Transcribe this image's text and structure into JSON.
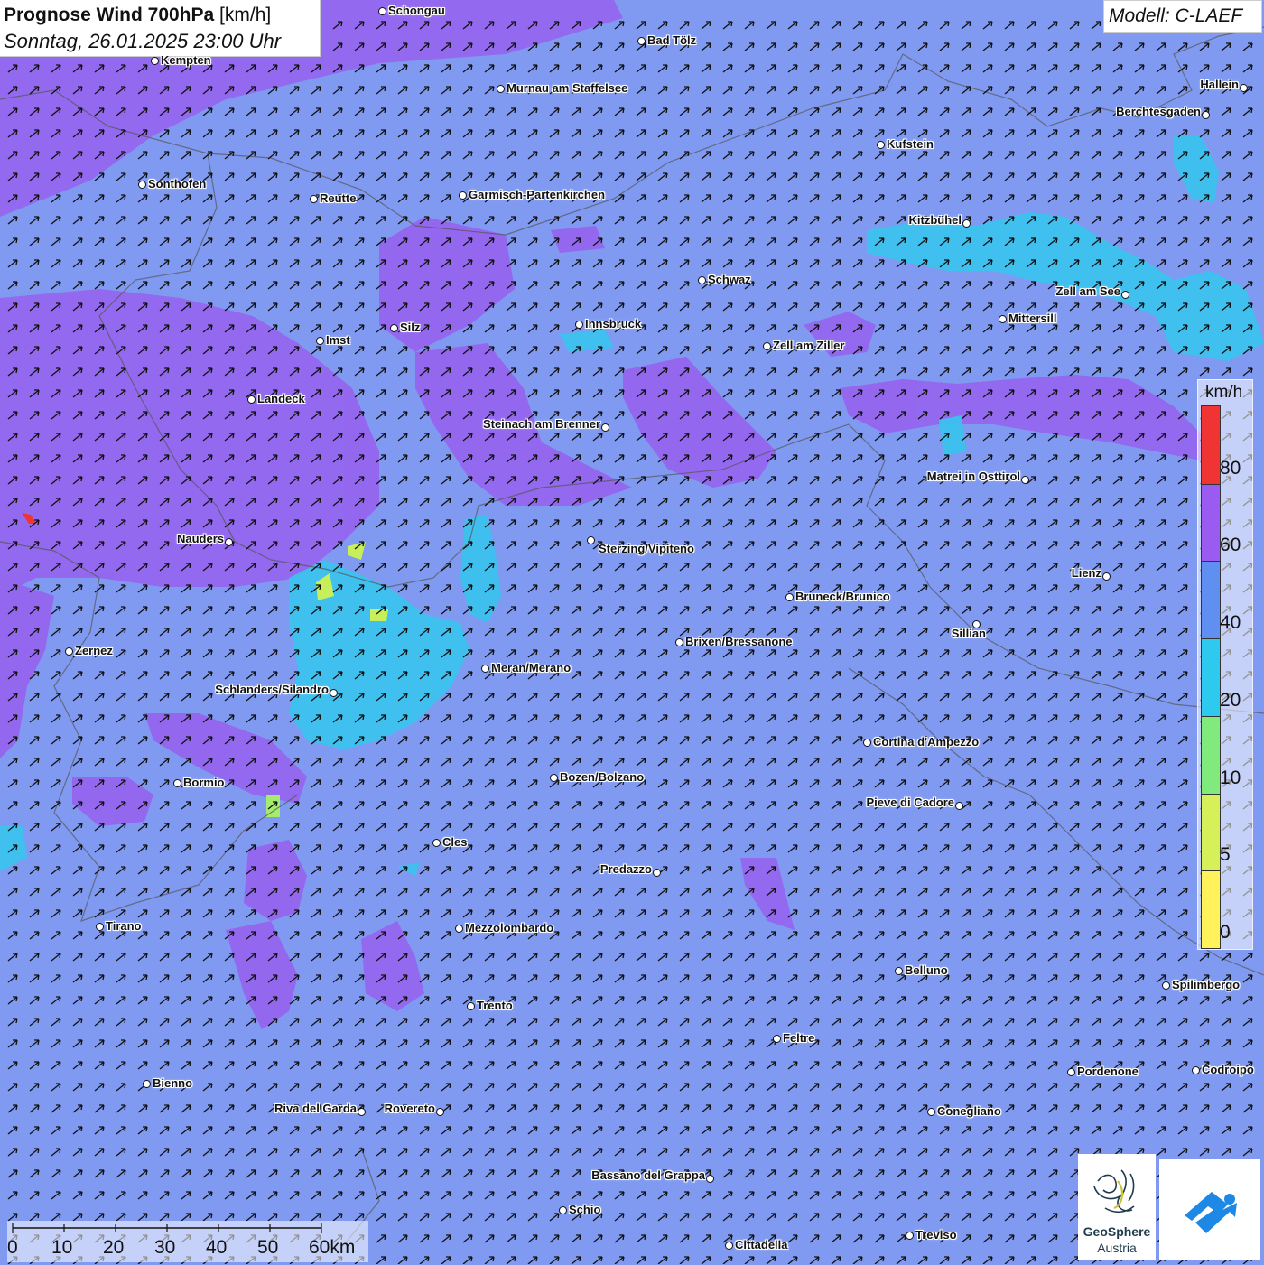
{
  "header": {
    "title_bold": "Prognose Wind 700hPa",
    "title_unit": "[km/h]",
    "datetime": "Sonntag, 26.01.2025 23:00 Uhr",
    "model": "Modell: C-LAEF"
  },
  "legend": {
    "unit": "km/h",
    "classes": [
      {
        "label": "0",
        "color": "#fff25a"
      },
      {
        "label": "5",
        "color": "#d6f05a"
      },
      {
        "label": "10",
        "color": "#80ea7c"
      },
      {
        "label": "20",
        "color": "#2ec9ee"
      },
      {
        "label": "40",
        "color": "#5f8ff0"
      },
      {
        "label": "60",
        "color": "#9a5cf0"
      },
      {
        "label": "80",
        "color": "#f03434"
      }
    ]
  },
  "scale": {
    "labels": [
      "0",
      "10",
      "20",
      "30",
      "40",
      "50",
      "60km"
    ]
  },
  "logo": {
    "name_bold": "GeoSphere",
    "name_light": "Austria"
  },
  "wind": {
    "direction": "southwest-to-northeast",
    "arrow_color": "#111111",
    "background_color": "#7f9af0"
  },
  "cities": [
    {
      "name": "Schongau"
    },
    {
      "name": "Bad Tölz"
    },
    {
      "name": "Kempten"
    },
    {
      "name": "Murnau am Staffelsee"
    },
    {
      "name": "Hallein"
    },
    {
      "name": "Berchtesgaden"
    },
    {
      "name": "Kufstein"
    },
    {
      "name": "Sonthofen"
    },
    {
      "name": "Reutte"
    },
    {
      "name": "Garmisch-Partenkirchen"
    },
    {
      "name": "Kitzbühel"
    },
    {
      "name": "Schwaz"
    },
    {
      "name": "Zell am See"
    },
    {
      "name": "Mittersill"
    },
    {
      "name": "Innsbruck"
    },
    {
      "name": "Imst"
    },
    {
      "name": "Silz"
    },
    {
      "name": "Zell am Ziller"
    },
    {
      "name": "Landeck"
    },
    {
      "name": "Steinach am Brenner"
    },
    {
      "name": "Matrei in Osttirol"
    },
    {
      "name": "Nauders"
    },
    {
      "name": "Sterzing/Vipiteno"
    },
    {
      "name": "Lienz"
    },
    {
      "name": "Bruneck/Brunico"
    },
    {
      "name": "Sillian"
    },
    {
      "name": "Zernez"
    },
    {
      "name": "Brixen/Bressanone"
    },
    {
      "name": "Meran/Merano"
    },
    {
      "name": "Schlanders/Silandro"
    },
    {
      "name": "Cortina d'Ampezzo"
    },
    {
      "name": "Bozen/Bolzano"
    },
    {
      "name": "Bormio"
    },
    {
      "name": "Pieve di Cadore"
    },
    {
      "name": "Cles"
    },
    {
      "name": "Predazzo"
    },
    {
      "name": "Tirano"
    },
    {
      "name": "Mezzolombardo"
    },
    {
      "name": "Belluno"
    },
    {
      "name": "Spilimbergo"
    },
    {
      "name": "Trento"
    },
    {
      "name": "Feltre"
    },
    {
      "name": "Pordenone"
    },
    {
      "name": "Codroipo"
    },
    {
      "name": "Bienno"
    },
    {
      "name": "Riva del Garda"
    },
    {
      "name": "Rovereto"
    },
    {
      "name": "Conegliano"
    },
    {
      "name": "Bassano del Grappa"
    },
    {
      "name": "Schio"
    },
    {
      "name": "Treviso"
    },
    {
      "name": "Cittadella"
    }
  ]
}
